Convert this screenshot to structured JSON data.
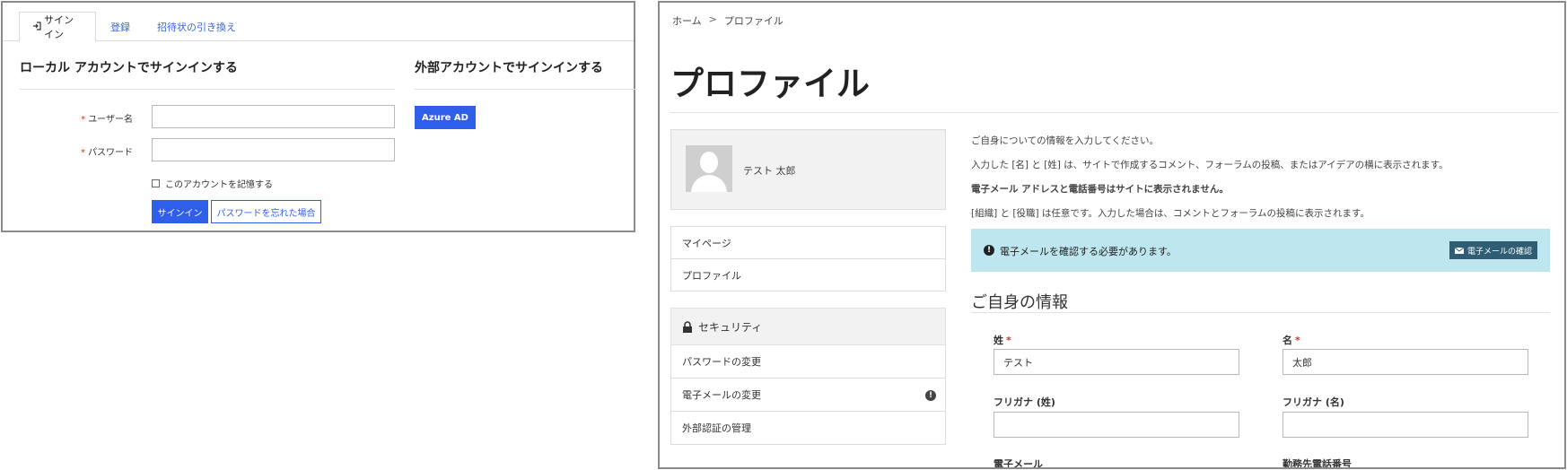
{
  "signin": {
    "tabs": [
      {
        "label": "サインイン",
        "icon": "sign-in-icon"
      },
      {
        "label": "登録"
      },
      {
        "label": "招待状の引き換え"
      }
    ],
    "local_title": "ローカル アカウントでサインインする",
    "external_title": "外部アカウントでサインインする",
    "required_mark": "*",
    "username_label": "ユーザー名",
    "username_value": "",
    "password_label": "パスワード",
    "password_value": "",
    "remember_label": "このアカウントを記憶する",
    "signin_button": "サインイン",
    "forgot_button": "パスワードを忘れた場合",
    "azure_button": "Azure AD",
    "accent_color": "#2f5fe8"
  },
  "profile": {
    "breadcrumb": [
      "ホーム",
      ">",
      "プロファイル"
    ],
    "page_title": "プロファイル",
    "user_name": "テスト 太郎",
    "nav": [
      "マイページ",
      "プロファイル"
    ],
    "security_label": "セキュリティ",
    "security_items": [
      "パスワードの変更",
      "電子メールの変更",
      "外部認証の管理"
    ],
    "alert_glyph": "!",
    "info_lines": [
      "ご自身についての情報を入力してください。",
      "入力した [名] と [姓] は、サイトで作成するコメント、フォーラムの投稿、またはアイデアの横に表示されます。",
      "電子メール アドレスと電話番号はサイトに表示されません。",
      "[組織] と [役職] は任意です。入力した場合は、コメントとフォーラムの投稿に表示されます。"
    ],
    "alert_text": "電子メールを確認する必要があります。",
    "verify_button": "電子メールの確認",
    "alert_bg": "#bde6ee",
    "section_heading": "ご自身の情報",
    "fields": {
      "last_name_label": "姓",
      "last_name_value": "テスト",
      "first_name_label": "名",
      "first_name_value": "太郎",
      "kana_last_label": "フリガナ (姓)",
      "kana_last_value": "",
      "kana_first_label": "フリガナ (名)",
      "kana_first_value": "",
      "email_label": "電子メール",
      "phone_label": "勤務先電話番号"
    }
  }
}
